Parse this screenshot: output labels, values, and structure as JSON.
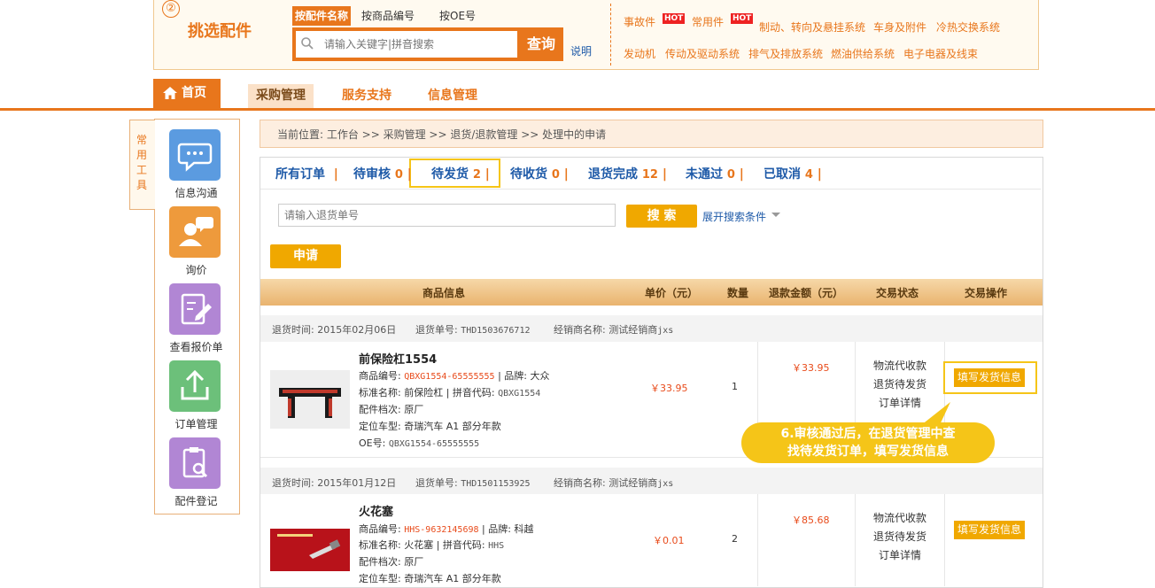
{
  "selector": {
    "step": "②",
    "title": "挑选配件",
    "search_tabs": [
      "按配件名称",
      "按商品编号",
      "按OE号"
    ],
    "search_placeholder": "请输入关键字|拼音搜索",
    "search_button": "查询",
    "help_link": "说明",
    "categories_row1": [
      {
        "label": "事故件",
        "hot": "HOT"
      },
      {
        "label": "常用件",
        "hot": "HOT"
      },
      {
        "label": "制动、转向及悬挂系统"
      },
      {
        "label": "车身及附件"
      },
      {
        "label": "冷热交换系统"
      }
    ],
    "categories_row2": [
      {
        "label": "发动机"
      },
      {
        "label": "传动及驱动系统"
      },
      {
        "label": "排气及排放系统"
      },
      {
        "label": "燃油供给系统"
      },
      {
        "label": "电子电器及线束"
      }
    ]
  },
  "nav": {
    "home": "首页",
    "tabs": [
      "采购管理",
      "服务支持",
      "信息管理"
    ]
  },
  "sidebar": {
    "tab_label": [
      "常",
      "用",
      "工",
      "具"
    ],
    "items": [
      {
        "label": "信息沟通",
        "icon": "chat-icon",
        "color": "#5b9be0"
      },
      {
        "label": "询价",
        "icon": "inquiry-icon",
        "color": "#ee9a3c"
      },
      {
        "label": "查看报价单",
        "icon": "quote-edit-icon",
        "color": "#b186d4"
      },
      {
        "label": "订单管理",
        "icon": "upload-order-icon",
        "color": "#6cc07a"
      },
      {
        "label": "配件登记",
        "icon": "parts-register-icon",
        "color": "#b186d4"
      }
    ]
  },
  "breadcrumb": {
    "text": "当前位置: 工作台 >> 采购管理 >> 退货/退款管理 >> 处理中的申请"
  },
  "status_tabs": [
    {
      "label": "所有订单",
      "count": ""
    },
    {
      "label": "待审核",
      "count": "0"
    },
    {
      "label": "待发货",
      "count": "2"
    },
    {
      "label": "待收货",
      "count": "0"
    },
    {
      "label": "退货完成",
      "count": "12"
    },
    {
      "label": "未通过",
      "count": "0"
    },
    {
      "label": "已取消",
      "count": "4"
    }
  ],
  "filter": {
    "placeholder": "请输入退货单号",
    "search_button": "搜 索",
    "expand_link": "展开搜索条件",
    "apply_button": "申请"
  },
  "table_headers": [
    "商品信息",
    "单价（元）",
    "数量",
    "退款金额（元）",
    "交易状态",
    "交易操作"
  ],
  "orders": [
    {
      "return_time_label": "退货时间: 2015年02月06日",
      "return_no_label": "退货单号:",
      "return_no": "THD1503676712",
      "dealer_label": "经销商名称: 测试经销商",
      "dealer_code": "jxs",
      "name": "前保险杠1554",
      "code_label": "商品编号:",
      "code": "QBXG1554-65555555",
      "brand": "| 品牌: 大众",
      "std_name": "标准名称: 前保险杠 | 拼音代码:",
      "pinyin": "QBXG1554",
      "grade": "配件档次: 原厂",
      "model": "定位车型: 奇瑞汽车 A1 部分年款",
      "oe_label": "OE号:",
      "oe": "QBXG1554-65555555",
      "unit_price": "￥33.95",
      "qty": "1",
      "refund": "￥33.95",
      "status": [
        "物流代收款",
        "退货待发货",
        "订单详情"
      ],
      "action": "填写发货信息"
    },
    {
      "return_time_label": "退货时间: 2015年01月12日",
      "return_no_label": "退货单号:",
      "return_no": "THD1501153925",
      "dealer_label": "经销商名称: 测试经销商",
      "dealer_code": "jxs",
      "name": "火花塞",
      "code_label": "商品编号:",
      "code": "HHS-9632145698",
      "brand": "| 品牌: 科越",
      "std_name": "标准名称: 火花塞 | 拼音代码:",
      "pinyin": "HHS",
      "grade": "配件档次: 原厂",
      "model": "定位车型: 奇瑞汽车 A1 部分年款",
      "unit_price": "￥0.01",
      "qty": "2",
      "refund": "￥85.68",
      "status": [
        "物流代收款",
        "退货待发货",
        "订单详情"
      ],
      "action": "填写发货信息"
    }
  ],
  "callout": {
    "line1": "6.审核通过后，在退货管理中查",
    "line2": "找待发货订单，填写发货信息"
  },
  "colors": {
    "accent": "#e8761c",
    "button": "#f0a800",
    "highlight": "#f5c518",
    "link": "#1e5aa8"
  }
}
